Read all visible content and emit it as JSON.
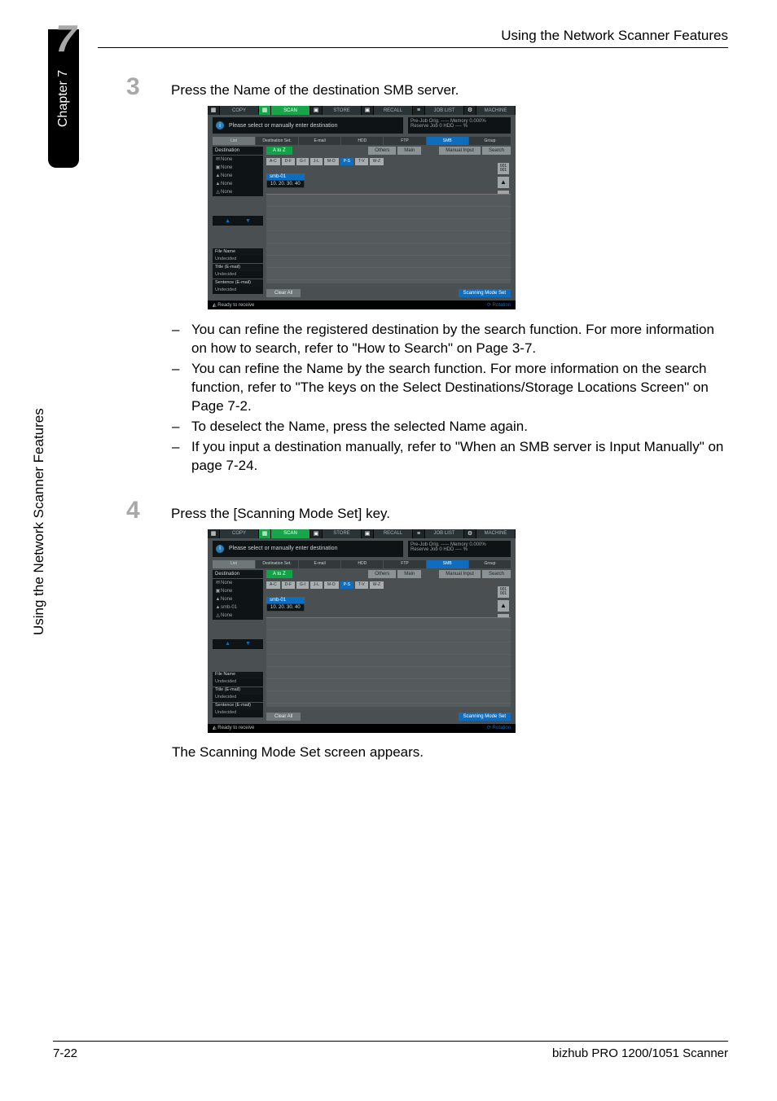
{
  "chapter_tab": "Chapter 7",
  "chapter_big": "7",
  "side_title": "Using the Network Scanner Features",
  "header": "Using the Network Scanner Features",
  "footer_left": "7-22",
  "footer_right": "bizhub PRO 1200/1051 Scanner",
  "step3": {
    "num": "3",
    "text": "Press the Name of the destination SMB server."
  },
  "step3_bullets": [
    "You can refine the registered destination by the search function. For more information on how to search, refer to \"How to Search\" on Page 3-7.",
    "You can refine the Name by the search function. For more information on the search function, refer to \"The keys on the Select Destinations/Storage Locations Screen\" on Page 7-2.",
    "To deselect the Name, press the selected Name again.",
    "If you input a destination manually, refer to \"When an SMB server is Input Manually\" on page 7-24."
  ],
  "step4": {
    "num": "4",
    "text": "Press the [Scanning Mode Set] key."
  },
  "step4_after": "The Scanning Mode Set screen appears.",
  "shot": {
    "toptabs": [
      "COPY",
      "SCAN",
      "STORE",
      "RECALL",
      "JOB LIST",
      "MACHINE"
    ],
    "topicons": [
      "▦",
      "▦",
      "▣",
      "▣",
      "≡",
      "⚙"
    ],
    "info_text": "Please select or manually enter destination",
    "info_right_l1": "Pre-Job Orig.  -----   Memory   0.000%",
    "info_right_l2": "Reserve Job       0   HDD      ---- %",
    "tabs2": {
      "list": "List",
      "dest_set": "Destination Set.",
      "email": "E-mail",
      "hdd": "HDD",
      "ftp": "FTP",
      "smb": "SMB",
      "group": "Group"
    },
    "left_header": "Destination",
    "left_none": "None",
    "left_smb": "smb-01",
    "arrows": {
      "up": "▲",
      "down": "▼"
    },
    "mid": {
      "atoz": "A to Z",
      "others": "Others",
      "main": "Main",
      "manual": "Manual Input",
      "search": "Search",
      "alpha": [
        "A-C",
        "D-F",
        "G-I",
        "J-L",
        "M-O",
        "P-S",
        "T-V",
        "W-Z"
      ],
      "alpha_active_index": 5,
      "entry_label": "smb-01",
      "entry_ip": "10. 20. 30. 40",
      "icons": [
        "001\n001",
        "▲",
        "▼"
      ]
    },
    "bottom_blocks": [
      {
        "hdr": "File Name",
        "val": "Undecided"
      },
      {
        "hdr": "Title (E-mail)",
        "val": "Undecided"
      },
      {
        "hdr": "Sentence (E-mail)",
        "val": "Undecided"
      }
    ],
    "clear_all": "Clear All",
    "sms": "Scanning Mode Set",
    "status_left": "◭ Ready to receive ",
    "status_right": "⟳ Rotation"
  },
  "shot2_left_items": [
    {
      "icon": "✉",
      "text": "None"
    },
    {
      "icon": "▣",
      "text": "None"
    },
    {
      "icon": "▲",
      "text": "None"
    },
    {
      "icon": "▲",
      "text": "smb-01"
    },
    {
      "icon": "◬",
      "text": "None"
    }
  ]
}
